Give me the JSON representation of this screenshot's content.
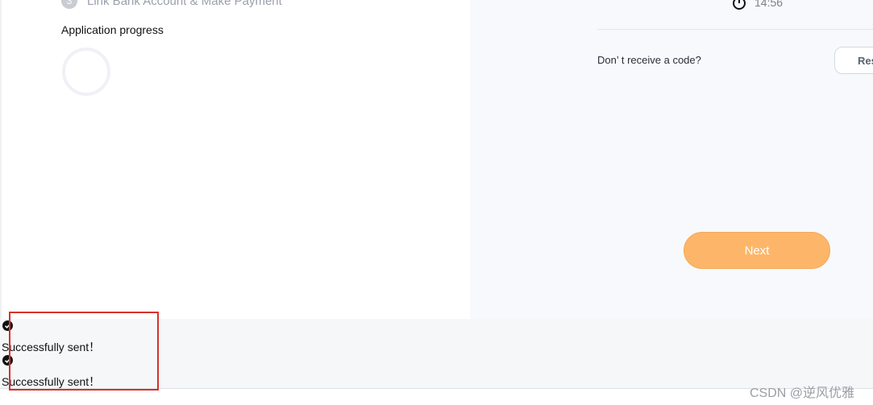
{
  "steps": {
    "partial_label": "Link Bank Account & Make Payment"
  },
  "progress": {
    "label": "Application progress"
  },
  "timer": {
    "value": "14:56",
    "icon": "clock-icon"
  },
  "resend": {
    "prompt": "Don’ t receive a code?",
    "button_label": "Resend"
  },
  "next": {
    "label": "Next"
  },
  "toasts": [
    {
      "text": "Successfully sent！",
      "icon": "check-circle-icon"
    },
    {
      "text": "Successfully sent！",
      "icon": "check-circle-icon"
    }
  ],
  "watermark": "CSDN @逆风优雅",
  "colors": {
    "accent": "#fdb669",
    "annotation": "#d9312b",
    "panel": "#f8f9fc"
  }
}
